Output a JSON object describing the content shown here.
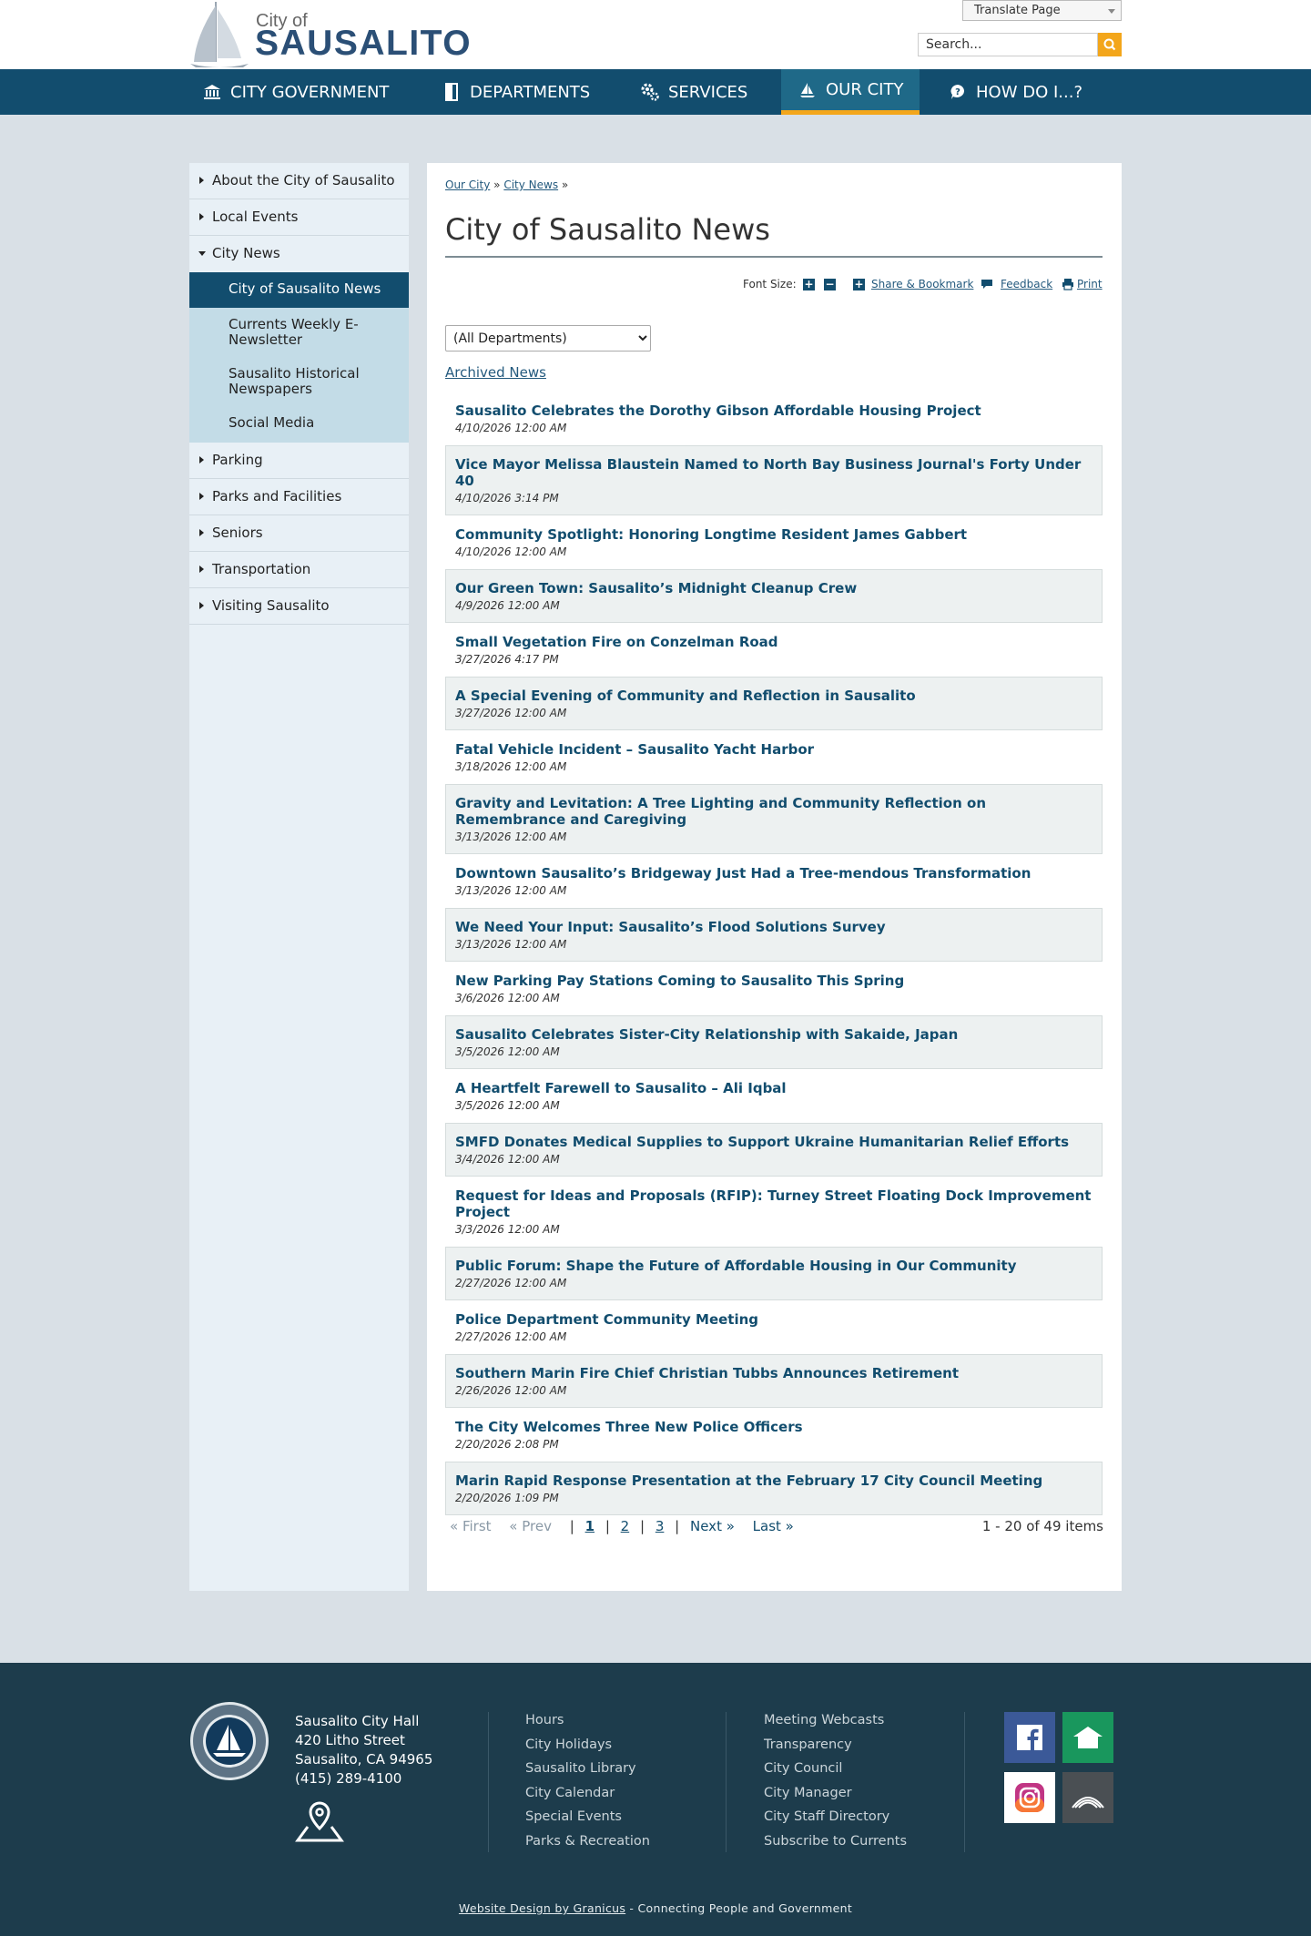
{
  "header": {
    "logo_small": "City of",
    "logo_big": "SAUSALITO",
    "translate_label": "Translate Page",
    "search_placeholder": "Search..."
  },
  "nav": {
    "items": [
      {
        "label": "CITY GOVERNMENT",
        "icon": "building-icon"
      },
      {
        "label": "DEPARTMENTS",
        "icon": "door-icon"
      },
      {
        "label": "SERVICES",
        "icon": "gears-icon"
      },
      {
        "label": "OUR CITY",
        "icon": "sailboat-icon"
      },
      {
        "label": "HOW DO I...?",
        "icon": "question-icon"
      }
    ]
  },
  "sidebar": {
    "items": [
      {
        "label": "About the City of Sausalito"
      },
      {
        "label": "Local Events"
      },
      {
        "label": "City News"
      },
      {
        "label": "Parking"
      },
      {
        "label": "Parks and Facilities"
      },
      {
        "label": "Seniors"
      },
      {
        "label": "Transportation"
      },
      {
        "label": "Visiting Sausalito"
      }
    ],
    "subitems": [
      {
        "label": "City of Sausalito News"
      },
      {
        "label": "Currents Weekly E-Newsletter"
      },
      {
        "label": "Sausalito Historical Newspapers"
      },
      {
        "label": "Social Media"
      }
    ]
  },
  "breadcrumb": {
    "item1": "Our City",
    "item2": "City News",
    "sep": "»"
  },
  "page_title": "City of Sausalito News",
  "toolbar": {
    "font_size": "Font Size:",
    "plus": "+",
    "minus": "−",
    "share": "Share & Bookmark",
    "feedback": "Feedback",
    "print": "Print"
  },
  "filter": {
    "selected": "(All Departments)"
  },
  "archived_label": "Archived News",
  "news": [
    {
      "title": "Sausalito Celebrates the Dorothy Gibson Affordable Housing Project",
      "date": "4/10/2026 12:00 AM"
    },
    {
      "title": "Vice Mayor Melissa Blaustein Named to North Bay Business Journal's Forty Under 40",
      "date": "4/10/2026 3:14 PM"
    },
    {
      "title": "Community Spotlight: Honoring Longtime Resident James Gabbert",
      "date": "4/10/2026 12:00 AM"
    },
    {
      "title": "Our Green Town: Sausalito’s Midnight Cleanup Crew",
      "date": "4/9/2026 12:00 AM"
    },
    {
      "title": "Small Vegetation Fire on Conzelman Road",
      "date": "3/27/2026 4:17 PM"
    },
    {
      "title": "A Special Evening of Community and Reflection in Sausalito",
      "date": "3/27/2026 12:00 AM"
    },
    {
      "title": "Fatal Vehicle Incident – Sausalito Yacht Harbor",
      "date": "3/18/2026 12:00 AM"
    },
    {
      "title": "Gravity and Levitation: A Tree Lighting and Community Reflection on Remembrance and Caregiving",
      "date": "3/13/2026 12:00 AM"
    },
    {
      "title": "Downtown Sausalito’s Bridgeway Just Had a Tree-mendous Transformation",
      "date": "3/13/2026 12:00 AM"
    },
    {
      "title": "We Need Your Input: Sausalito’s Flood Solutions Survey",
      "date": "3/13/2026 12:00 AM"
    },
    {
      "title": "New Parking Pay Stations Coming to Sausalito This Spring",
      "date": "3/6/2026 12:00 AM"
    },
    {
      "title": "Sausalito Celebrates Sister-City Relationship with Sakaide, Japan",
      "date": "3/5/2026 12:00 AM"
    },
    {
      "title": "A Heartfelt Farewell to Sausalito – Ali Iqbal",
      "date": "3/5/2026 12:00 AM"
    },
    {
      "title": "SMFD Donates Medical Supplies to Support Ukraine Humanitarian Relief Efforts",
      "date": "3/4/2026 12:00 AM"
    },
    {
      "title": "Request for Ideas and Proposals (RFIP): Turney Street Floating Dock Improvement Project",
      "date": "3/3/2026 12:00 AM"
    },
    {
      "title": "Public Forum: Shape the Future of Affordable Housing in Our Community",
      "date": "2/27/2026 12:00 AM"
    },
    {
      "title": "Police Department Community Meeting",
      "date": "2/27/2026 12:00 AM"
    },
    {
      "title": "Southern Marin Fire Chief Christian Tubbs Announces Retirement",
      "date": "2/26/2026 12:00 AM"
    },
    {
      "title": "The City Welcomes Three New Police Officers",
      "date": "2/20/2026 2:08 PM"
    },
    {
      "title": "Marin Rapid Response Presentation at the February 17 City Council Meeting",
      "date": "2/20/2026 1:09 PM"
    }
  ],
  "pager": {
    "first": "« First",
    "prev": "« Prev",
    "sep": "|",
    "p1": "1",
    "p2": "2",
    "p3": "3",
    "next": "Next »",
    "last": "Last »",
    "count": "1 - 20 of 49 items"
  },
  "footer": {
    "addr_name": "Sausalito City Hall",
    "addr_street": "420 Litho Street",
    "addr_city": "Sausalito, CA 94965",
    "addr_phone": "(415) 289-4100",
    "col1": [
      "Hours",
      "City Holidays",
      "Sausalito Library",
      "City Calendar",
      "Special Events",
      "Parks & Recreation"
    ],
    "col2": [
      "Meeting Webcasts",
      "Transparency",
      "City Council",
      "City Manager",
      "City Staff Directory",
      "Subscribe to Currents"
    ],
    "social": [
      "facebook-icon",
      "nextdoor-icon",
      "instagram-icon",
      "bridge-icon"
    ],
    "credit_link": "Website Design by Granicus",
    "credit_rest": " - Connecting People and Government",
    "colors": {
      "facebook": "#3b5998",
      "nextdoor": "#19975d",
      "instagram": "#ffffff",
      "bridge": "#4a4f53"
    }
  }
}
